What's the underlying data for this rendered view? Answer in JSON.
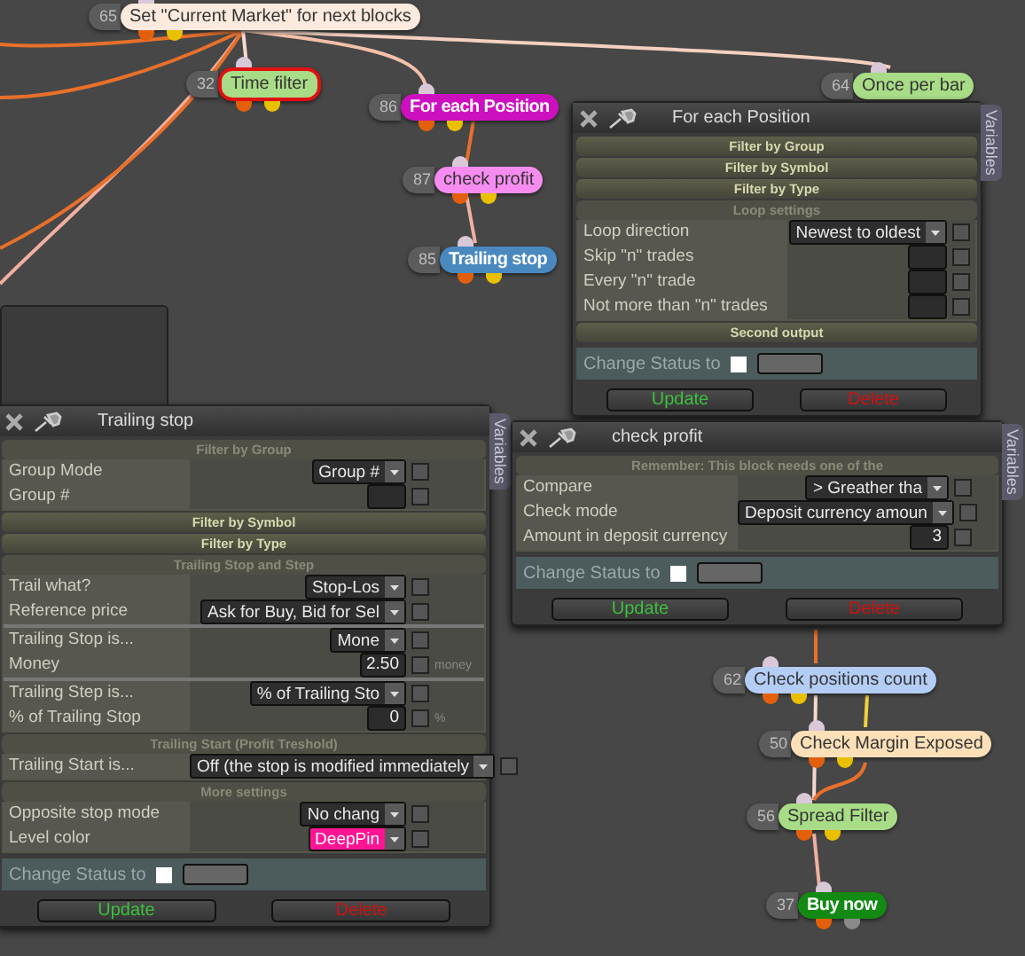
{
  "nodes": [
    {
      "number": "65",
      "label": "Set \"Current Market\" for next blocks",
      "color": "#fbeadd",
      "bold": false,
      "selected": false,
      "kind": "condition"
    },
    {
      "number": "32",
      "label": "Time filter",
      "color": "#a9dc86",
      "bold": false,
      "selected": true,
      "kind": "condition"
    },
    {
      "number": "86",
      "label": "For each Position",
      "color": "#cc10c0",
      "bold": true,
      "selected": false,
      "kind": "condition"
    },
    {
      "number": "87",
      "label": "check profit",
      "color": "#f68cf0",
      "bold": false,
      "selected": false,
      "kind": "condition"
    },
    {
      "number": "85",
      "label": "Trailing stop",
      "color": "#4a88c0",
      "bold": true,
      "selected": false,
      "kind": "condition"
    },
    {
      "number": "64",
      "label": "Once per bar",
      "color": "#a9dc86",
      "bold": false,
      "selected": false
    },
    {
      "number": "62",
      "label": "Check positions count",
      "color": "#b4cdf5",
      "bold": false,
      "selected": false,
      "kind": "condition"
    },
    {
      "number": "50",
      "label": "Check Margin Exposed",
      "color": "#fde0b8",
      "bold": false,
      "selected": false,
      "kind": "condition"
    },
    {
      "number": "56",
      "label": "Spread Filter",
      "color": "#a9dc86",
      "bold": false,
      "selected": false,
      "kind": "condition"
    },
    {
      "number": "37",
      "label": "Buy now",
      "color": "#138a13",
      "bold": true,
      "selected": false,
      "kind": "action"
    }
  ],
  "panels": [
    {
      "title": "For each Position",
      "variables_tab": "Variables",
      "sections": [
        {
          "header": "Filter by Group",
          "expanded": false
        },
        {
          "header": "Filter by Symbol",
          "expanded": false
        },
        {
          "header": "Filter by Type",
          "expanded": false
        },
        {
          "header": "Loop settings",
          "expanded": true,
          "rows": [
            {
              "label": "Loop direction",
              "control": {
                "kind": "select",
                "value": "Newest to oldest"
              },
              "checked": false,
              "divider": false
            },
            {
              "label": "Skip \"n\" trades",
              "control": {
                "kind": "number"
              },
              "checked": false,
              "divider": false
            },
            {
              "label": "Every \"n\" trade",
              "control": {
                "kind": "number"
              },
              "checked": false,
              "divider": false
            },
            {
              "label": "Not more than \"n\" trades",
              "control": {
                "kind": "number"
              },
              "checked": false,
              "divider": false
            }
          ]
        },
        {
          "header": "Second output",
          "expanded": false
        }
      ],
      "change_status": {
        "label": "Change Status to",
        "checked": false
      },
      "buttons": [
        {
          "label": "Update",
          "kind": "update"
        },
        {
          "label": "Delete",
          "kind": "delete"
        }
      ]
    },
    {
      "title": "Trailing stop",
      "variables_tab": "Variables",
      "sections": [
        {
          "header": "Filter by Group",
          "expanded": true,
          "rows": [
            {
              "label": "Group Mode",
              "control": {
                "kind": "select",
                "value": "Group #"
              },
              "checked": false,
              "divider": false
            },
            {
              "label": "Group #",
              "control": {
                "kind": "number"
              },
              "checked": false,
              "divider": false
            }
          ]
        },
        {
          "header": "Filter by Symbol",
          "expanded": false
        },
        {
          "header": "Filter by Type",
          "expanded": false
        },
        {
          "header": "Trailing Stop and Step",
          "expanded": true,
          "rows": [
            {
              "label": "Trail what?",
              "control": {
                "kind": "select",
                "value": "Stop-Los"
              },
              "checked": false,
              "divider": false
            },
            {
              "label": "Reference price",
              "control": {
                "kind": "select",
                "value": "Ask for Buy, Bid for Sel"
              },
              "checked": false,
              "divider": false
            },
            {
              "label": "Trailing Stop is...",
              "control": {
                "kind": "select",
                "value": "Mone"
              },
              "checked": false,
              "divider": true
            },
            {
              "label": "Money",
              "control": {
                "kind": "number",
                "value": "2.50"
              },
              "checked": false,
              "unit": "money",
              "divider": false
            },
            {
              "label": "Trailing Step is...",
              "control": {
                "kind": "select",
                "value": "% of Trailing Sto"
              },
              "checked": false,
              "divider": true
            },
            {
              "label": "% of Trailing Stop",
              "control": {
                "kind": "number",
                "value": "0"
              },
              "checked": false,
              "unit": "%",
              "divider": false
            }
          ]
        },
        {
          "header": "Trailing Start (Profit Treshold)",
          "expanded": true,
          "rows": [
            {
              "label": "Trailing Start is...",
              "control": {
                "kind": "select",
                "value": "Off (the stop is modified immediately"
              },
              "checked": false,
              "divider": false
            }
          ]
        },
        {
          "header": "More settings",
          "expanded": true,
          "rows": [
            {
              "label": "Opposite stop mode",
              "control": {
                "kind": "select",
                "value": "No chang"
              },
              "checked": false,
              "divider": false
            },
            {
              "label": "Level color",
              "control": {
                "kind": "select",
                "value": "DeepPin",
                "color": "#ff1493"
              },
              "checked": false,
              "divider": false
            }
          ]
        }
      ],
      "change_status": {
        "label": "Change Status to",
        "checked": false
      },
      "buttons": [
        {
          "label": "Update",
          "kind": "update"
        },
        {
          "label": "Delete",
          "kind": "delete"
        }
      ]
    },
    {
      "title": "check profit",
      "variables_tab": "Variables",
      "sections": [
        {
          "header": "Remember: This block needs one of the",
          "expanded": true,
          "rows": [
            {
              "label": "Compare",
              "control": {
                "kind": "select",
                "value": "> Greather tha"
              },
              "checked": false,
              "divider": false
            },
            {
              "label": "Check mode",
              "control": {
                "kind": "select",
                "value": "Deposit currency amoun"
              },
              "checked": false,
              "divider": false
            },
            {
              "label": "Amount in deposit currency",
              "control": {
                "kind": "number",
                "value": "3"
              },
              "checked": false,
              "divider": false
            }
          ]
        }
      ],
      "change_status": {
        "label": "Change Status to",
        "checked": false
      },
      "buttons": [
        {
          "label": "Update",
          "kind": "update"
        },
        {
          "label": "Delete",
          "kind": "delete"
        }
      ]
    }
  ]
}
